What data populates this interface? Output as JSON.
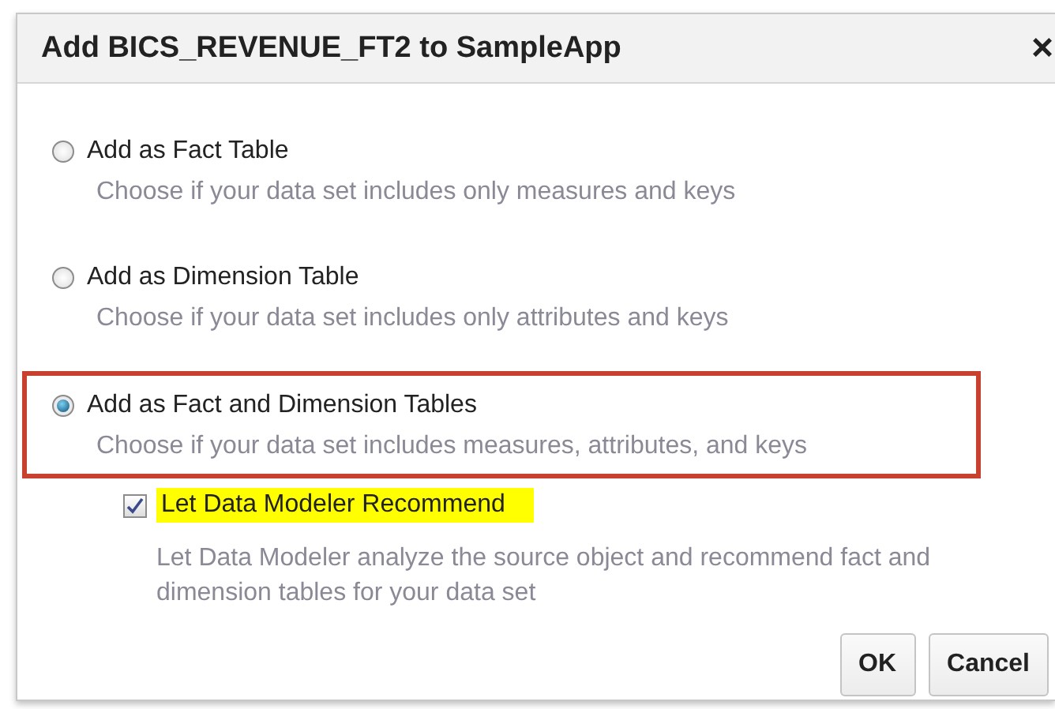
{
  "window": {
    "title": "Add BICS_REVENUE_FT2 to SampleApp",
    "close": "×"
  },
  "options": [
    {
      "label": "Add as Fact Table",
      "description": "Choose if your data set includes only measures and keys",
      "selected": false,
      "highlighted": false
    },
    {
      "label": "Add as Dimension Table",
      "description": "Choose if your data set includes only attributes and keys",
      "selected": false,
      "highlighted": false
    },
    {
      "label": "Add as Fact and Dimension Tables",
      "description": "Choose if your data set includes measures, attributes, and keys",
      "selected": true,
      "highlighted": true
    }
  ],
  "recommend": {
    "label": "Let Data Modeler Recommend",
    "checked": true,
    "highlighted": true,
    "description": "Let Data Modeler analyze the source object and recommend fact and dimension tables for your data set"
  },
  "buttons": [
    "OK",
    "Cancel"
  ]
}
